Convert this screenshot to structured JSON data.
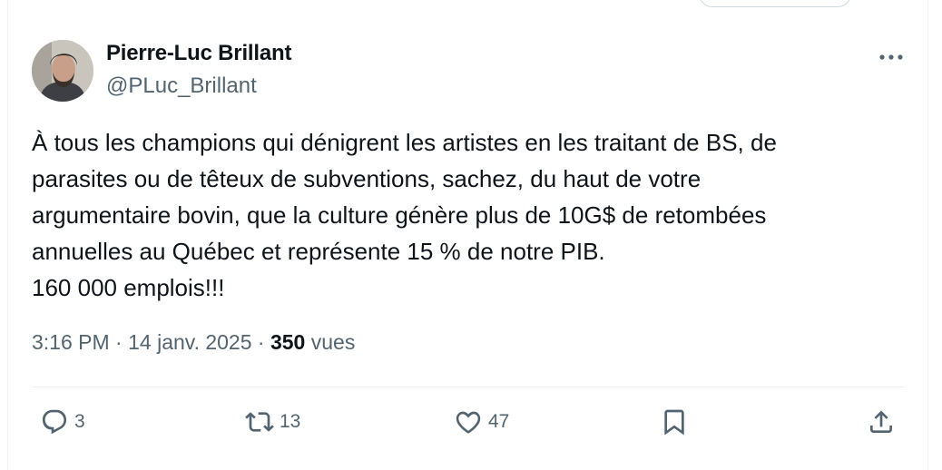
{
  "author": {
    "name": "Pierre-Luc Brillant",
    "handle": "@PLuc_Brillant"
  },
  "tweet": {
    "lines": [
      "À tous les champions qui dénigrent les artistes en les traitant de BS, de",
      "parasites ou de têteux de subventions, sachez, du haut de votre",
      "argumentaire bovin, que la culture génère plus de 10G$ de retombées",
      "annuelles au Québec et représente 15 % de notre PIB.",
      "160 000 emplois!!!"
    ]
  },
  "meta": {
    "time": "3:16 PM",
    "separator": "·",
    "date": "14 janv. 2025",
    "views_count": "350",
    "views_label": "vues"
  },
  "actions": {
    "replies": "3",
    "reposts": "13",
    "likes": "47"
  },
  "colors": {
    "text": "#0f1419",
    "secondary": "#536471",
    "border": "#eff3f4"
  },
  "icons": [
    "more-icon",
    "reply-icon",
    "repost-icon",
    "like-icon",
    "bookmark-icon",
    "share-icon"
  ]
}
